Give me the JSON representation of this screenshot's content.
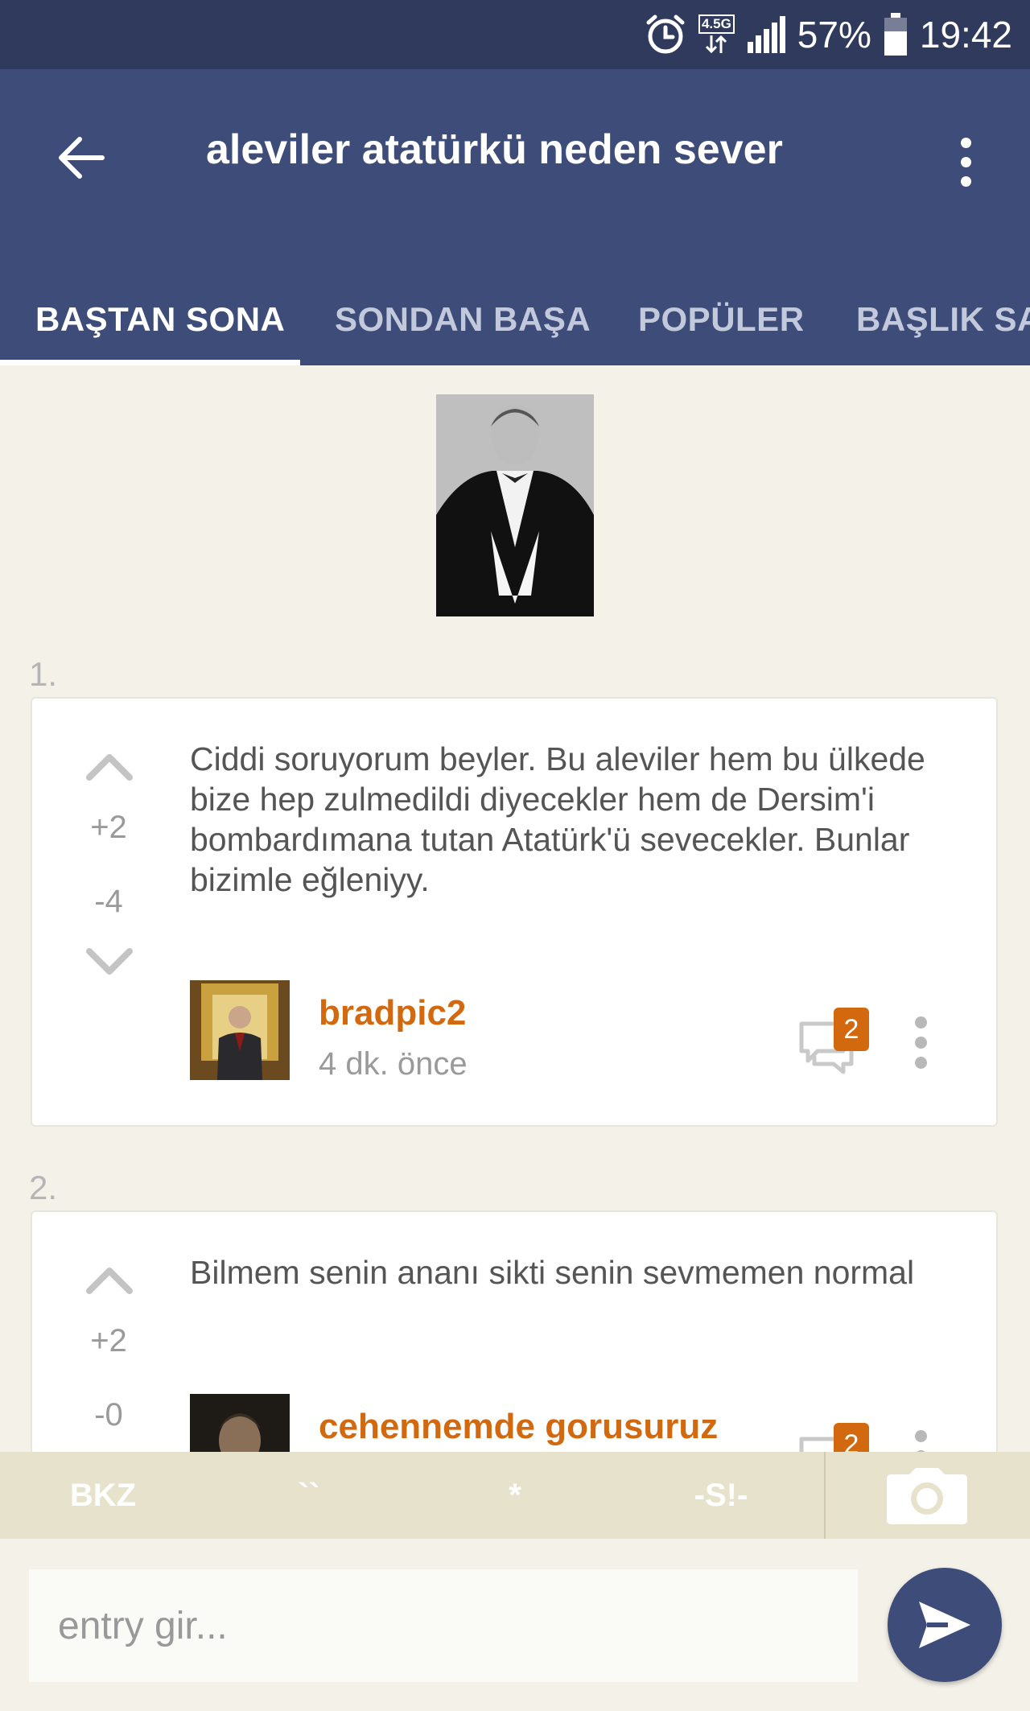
{
  "status_bar": {
    "network": "4.5G",
    "battery_percent": "57%",
    "time": "19:42",
    "icons": [
      "alarm-icon",
      "network-4g-icon",
      "signal-icon",
      "battery-icon"
    ]
  },
  "header": {
    "title": "aleviler atatürkü neden sever",
    "back_icon": "arrow-left-icon",
    "menu_icon": "more-vertical-icon"
  },
  "tabs": [
    {
      "label": "BAŞTAN SONA",
      "active": true
    },
    {
      "label": "SONDAN BAŞA",
      "active": false
    },
    {
      "label": "POPÜLER",
      "active": false
    },
    {
      "label": "BAŞLIK SAH",
      "active": false
    }
  ],
  "entries": [
    {
      "number": "1.",
      "upvotes": "+2",
      "downvotes": "-4",
      "text": "Ciddi soruyorum beyler. Bu aleviler hem bu ülkede bize hep zulmedildi diyecekler hem de Dersim'i bombardımana tutan Atatürk'ü sevecekler. Bunlar bizimle eğleniyy.",
      "author": "bradpic2",
      "time": "4 dk. önce",
      "comment_count": "2"
    },
    {
      "number": "2.",
      "upvotes": "+2",
      "downvotes": "-0",
      "text": "Bilmem senin ananı sikti senin sevmemen normal",
      "author": "cehennemde gorusuruz",
      "time": "",
      "comment_count": "2"
    }
  ],
  "format_bar": {
    "buttons": [
      "BKZ",
      "``",
      "*",
      "-S!-"
    ],
    "camera_icon": "camera-icon"
  },
  "composer": {
    "placeholder": "entry gir...",
    "value": "",
    "send_icon": "send-icon"
  },
  "colors": {
    "primary": "#3d4c78",
    "status_bar": "#2f3a5c",
    "accent": "#d2690e",
    "background": "#f3f1e8"
  }
}
